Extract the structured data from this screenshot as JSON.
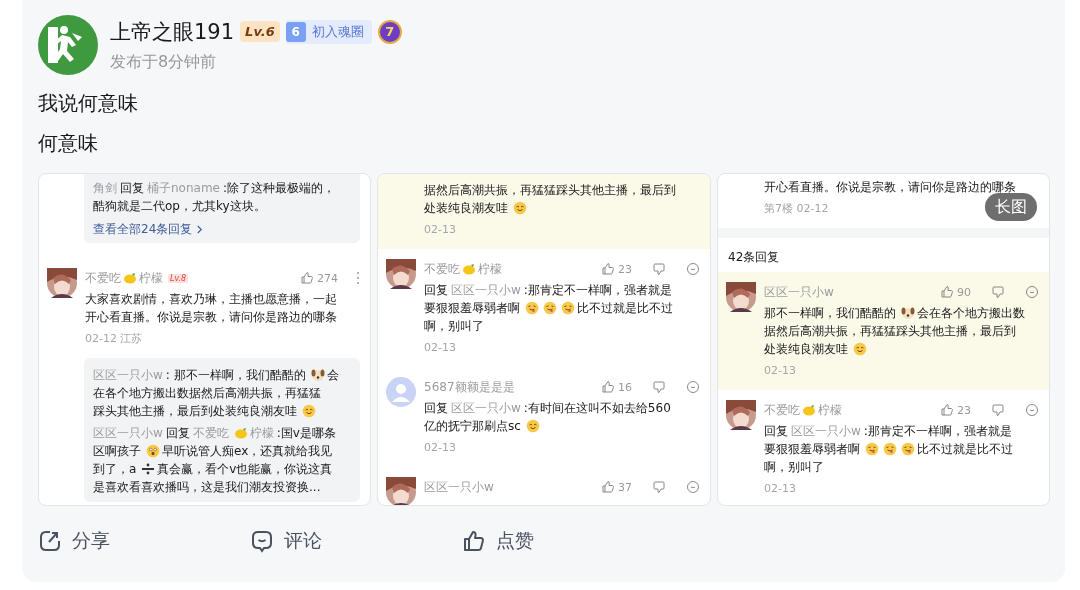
{
  "author": {
    "name": "上帝之眼191",
    "level": "Lv.6",
    "fan_level": "6",
    "fan_title": "初入魂圈",
    "medal": "7",
    "time": "发布于8分钟前"
  },
  "post_lines": [
    "我说何意味",
    "何意味"
  ],
  "panels": [
    {
      "blocks": [
        {
          "kind": "reply_box",
          "paragraphs": [
            [
              [
                {
                  "kind": "text",
                  "text": "角剑",
                  "muted": true
                },
                {
                  "kind": "text",
                  "text": "回复",
                  "muted": false
                },
                {
                  "kind": "text",
                  "text": "桶子noname",
                  "muted": true
                },
                {
                  "kind": "text",
                  "text": ":除了这种最极端的，",
                  "muted": false
                }
              ],
              [
                {
                  "kind": "text",
                  "text": "酷狗就是二代op，尤其ky这块。",
                  "muted": false
                }
              ]
            ]
          ],
          "more": "查看全部24条回复"
        },
        {
          "kind": "comment",
          "highlighted": false,
          "default_avatar": false,
          "name": [
            {
              "kind": "text",
              "text": "不爱吃",
              "muted": true
            },
            {
              "kind": "lemon"
            },
            {
              "kind": "text",
              "text": "柠檬",
              "muted": true
            }
          ],
          "level": "Lv.8",
          "likes": "274",
          "menu": true,
          "lines": [
            [
              {
                "kind": "text",
                "text": "大家喜欢剧情，喜欢乃琳，主播也愿意播，一起",
                "muted": false
              }
            ],
            [
              {
                "kind": "text",
                "text": "开心看直播。你说是宗教，请问你是路边的哪条",
                "muted": false
              }
            ]
          ],
          "date": "02-12 江苏"
        },
        {
          "kind": "reply_box",
          "paragraphs": [
            [
              [
                {
                  "kind": "text",
                  "text": "区区一只小w",
                  "muted": true
                },
                {
                  "kind": "text",
                  "text": ": 那不一样啊，我们酷酷的",
                  "muted": false
                },
                {
                  "kind": "dog"
                },
                {
                  "kind": "text",
                  "text": "会",
                  "muted": false
                }
              ],
              [
                {
                  "kind": "text",
                  "text": "在各个地方搬出数据然后高潮共振，再猛猛",
                  "muted": false
                }
              ],
              [
                {
                  "kind": "text",
                  "text": "踩头其他主播，最后到处装纯良潮友哇",
                  "muted": false
                },
                {
                  "kind": "smile"
                }
              ]
            ],
            [
              [
                {
                  "kind": "text",
                  "text": "区区一只小w",
                  "muted": true
                },
                {
                  "kind": "text",
                  "text": "回复",
                  "muted": false
                },
                {
                  "kind": "text",
                  "text": "不爱吃",
                  "muted": true
                },
                {
                  "kind": "lemon"
                },
                {
                  "kind": "text",
                  "text": "柠檬",
                  "muted": true
                },
                {
                  "kind": "text",
                  "text": ":国v是哪条",
                  "muted": false
                }
              ],
              [
                {
                  "kind": "text",
                  "text": "区啊孩子",
                  "muted": false
                },
                {
                  "kind": "shock"
                },
                {
                  "kind": "text",
                  "text": "早听说管人痴ex，还真就给我见",
                  "muted": false
                }
              ],
              [
                {
                  "kind": "text",
                  "text": "到了，a",
                  "muted": false
                },
                {
                  "kind": "divide"
                },
                {
                  "kind": "text",
                  "text": "真会赢，看个v也能赢，你说这真",
                  "muted": false
                }
              ],
              [
                {
                  "kind": "text",
                  "text": "是喜欢看喜欢播吗，这是我们潮友投资换...",
                  "muted": false
                }
              ]
            ]
          ]
        }
      ]
    },
    {
      "blocks": [
        {
          "kind": "tail",
          "highlighted": true,
          "lines": [
            [
              {
                "kind": "text",
                "text": "据然后高潮共振，再猛猛踩头其他主播，最后到",
                "muted": false
              }
            ],
            [
              {
                "kind": "text",
                "text": "处装纯良潮友哇",
                "muted": false
              },
              {
                "kind": "smile"
              }
            ]
          ],
          "date": "02-13"
        },
        {
          "kind": "comment",
          "highlighted": false,
          "default_avatar": false,
          "name": [
            {
              "kind": "text",
              "text": "不爱吃",
              "muted": true
            },
            {
              "kind": "lemon"
            },
            {
              "kind": "text",
              "text": "柠檬",
              "muted": true
            }
          ],
          "likes": "23",
          "menu": false,
          "lines": [
            [
              {
                "kind": "text",
                "text": "回复",
                "muted": false
              },
              {
                "kind": "text",
                "text": "区区一只小w",
                "muted": true
              },
              {
                "kind": "text",
                "text": ":那肯定不一样啊，强者就是",
                "muted": false
              }
            ],
            [
              {
                "kind": "text",
                "text": "要狠狠羞辱弱者啊",
                "muted": false
              },
              {
                "kind": "yum"
              },
              {
                "kind": "yum"
              },
              {
                "kind": "yum"
              },
              {
                "kind": "text",
                "text": "比不过就是比不过",
                "muted": false
              }
            ],
            [
              {
                "kind": "text",
                "text": "啊，别叫了",
                "muted": false
              }
            ]
          ],
          "date": "02-13"
        },
        {
          "kind": "comment",
          "highlighted": false,
          "default_avatar": true,
          "name": [
            {
              "kind": "text",
              "text": "5687额额是是是",
              "muted": true
            }
          ],
          "likes": "16",
          "menu": false,
          "lines": [
            [
              {
                "kind": "text",
                "text": "回复",
                "muted": false
              },
              {
                "kind": "text",
                "text": "区区一只小w",
                "muted": true
              },
              {
                "kind": "text",
                "text": ":有时间在这叫不如去给560",
                "muted": false
              }
            ],
            [
              {
                "kind": "text",
                "text": "亿的抚宁那刷点sc",
                "muted": false
              },
              {
                "kind": "smile"
              }
            ]
          ],
          "date": "02-13"
        },
        {
          "kind": "comment",
          "highlighted": false,
          "default_avatar": false,
          "name": [
            {
              "kind": "text",
              "text": "区区一只小w",
              "muted": true
            }
          ],
          "likes": "37",
          "menu": false
        }
      ]
    },
    {
      "badge": "长图",
      "blocks": [
        {
          "kind": "tail",
          "highlighted": false,
          "lines": [
            [
              {
                "kind": "text",
                "text": "开心看直播。你说是宗教，请问你是路边的哪条",
                "muted": false
              }
            ]
          ],
          "date": "第7楼 02-12"
        },
        {
          "kind": "band"
        },
        {
          "kind": "count",
          "text": "42条回复"
        },
        {
          "kind": "comment",
          "highlighted": true,
          "default_avatar": false,
          "name": [
            {
              "kind": "text",
              "text": "区区一只小w",
              "muted": true
            }
          ],
          "likes": "90",
          "menu": false,
          "lines": [
            [
              {
                "kind": "text",
                "text": "那不一样啊，我们酷酷的",
                "muted": false
              },
              {
                "kind": "dog"
              },
              {
                "kind": "text",
                "text": "会在各个地方搬出数",
                "muted": false
              }
            ],
            [
              {
                "kind": "text",
                "text": "据然后高潮共振，再猛猛踩头其他主播，最后到",
                "muted": false
              }
            ],
            [
              {
                "kind": "text",
                "text": "处装纯良潮友哇",
                "muted": false
              },
              {
                "kind": "smile"
              }
            ]
          ],
          "date": "02-13"
        },
        {
          "kind": "comment",
          "highlighted": false,
          "default_avatar": false,
          "name": [
            {
              "kind": "text",
              "text": "不爱吃",
              "muted": true
            },
            {
              "kind": "lemon"
            },
            {
              "kind": "text",
              "text": "柠檬",
              "muted": true
            }
          ],
          "likes": "23",
          "menu": false,
          "lines": [
            [
              {
                "kind": "text",
                "text": "回复",
                "muted": false
              },
              {
                "kind": "text",
                "text": "区区一只小w",
                "muted": true
              },
              {
                "kind": "text",
                "text": ":那肯定不一样啊，强者就是",
                "muted": false
              }
            ],
            [
              {
                "kind": "text",
                "text": "要狠狠羞辱弱者啊",
                "muted": false
              },
              {
                "kind": "yum"
              },
              {
                "kind": "yum"
              },
              {
                "kind": "yum"
              },
              {
                "kind": "text",
                "text": "比不过就是比不过",
                "muted": false
              }
            ],
            [
              {
                "kind": "text",
                "text": "啊，别叫了",
                "muted": false
              }
            ]
          ],
          "date": "02-13"
        }
      ]
    }
  ],
  "actions": [
    {
      "kind": "share",
      "label": "分享"
    },
    {
      "kind": "comment",
      "label": "评论"
    },
    {
      "kind": "like",
      "label": "点赞"
    }
  ]
}
